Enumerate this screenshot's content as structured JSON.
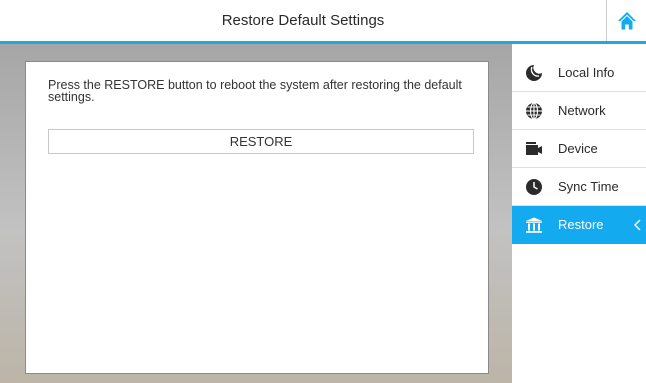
{
  "header": {
    "title": "Restore Default Settings",
    "home_icon": "home-icon",
    "accent_color": "#24a7e0"
  },
  "main": {
    "message": "Press the RESTORE button to reboot the system after restoring the default settings.",
    "restore_button_label": "RESTORE"
  },
  "sidebar": {
    "active_color": "#13aaf0",
    "items": [
      {
        "label": "Local Info",
        "icon": "moon-icon",
        "active": false
      },
      {
        "label": "Network",
        "icon": "globe-icon",
        "active": false
      },
      {
        "label": "Device",
        "icon": "device-icon",
        "active": false
      },
      {
        "label": "Sync Time",
        "icon": "clock-icon",
        "active": false
      },
      {
        "label": "Restore",
        "icon": "bank-icon",
        "active": true
      }
    ]
  }
}
